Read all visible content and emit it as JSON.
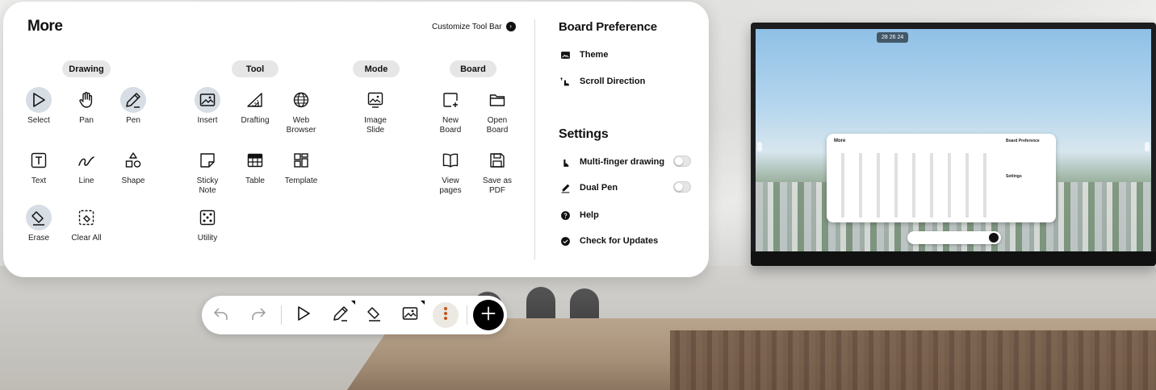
{
  "more_panel": {
    "title": "More",
    "customize_label": "Customize Tool Bar",
    "categories": {
      "drawing": "Drawing",
      "tool": "Tool",
      "mode": "Mode",
      "board": "Board"
    },
    "tools": {
      "select": "Select",
      "pan": "Pan",
      "pen": "Pen",
      "text": "Text",
      "line": "Line",
      "shape": "Shape",
      "erase": "Erase",
      "clear_all": "Clear All",
      "insert": "Insert",
      "drafting": "Drafting",
      "web_browser": "Web\nBrowser",
      "sticky_note": "Sticky\nNote",
      "table": "Table",
      "template": "Template",
      "utility": "Utility",
      "image_slide": "Image\nSlide",
      "new_board": "New\nBoard",
      "open_board": "Open\nBoard",
      "view_pages": "View\npages",
      "save_as_pdf": "Save as\nPDF"
    }
  },
  "board_preference": {
    "title": "Board Preference",
    "theme": "Theme",
    "scroll_direction": "Scroll Direction"
  },
  "settings": {
    "title": "Settings",
    "multi_finger": "Multi-finger drawing",
    "multi_finger_on": false,
    "dual_pen": "Dual Pen",
    "dual_pen_on": false,
    "help": "Help",
    "check_updates": "Check for Updates"
  },
  "tv": {
    "clock": "28 26 24"
  },
  "icons": [
    "undo-icon",
    "redo-icon",
    "select-icon",
    "pen-icon",
    "eraser-icon",
    "insert-image-icon",
    "more-icon",
    "menu-icon"
  ]
}
